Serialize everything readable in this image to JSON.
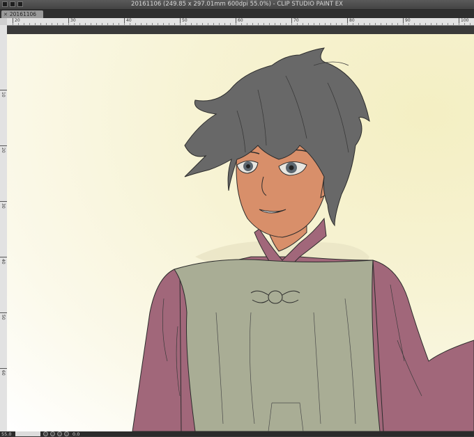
{
  "window": {
    "title": "20161106 (249.85 x 297.01mm 600dpi 55.0%)  - CLIP STUDIO PAINT EX"
  },
  "tabs": [
    {
      "label": "20161106",
      "close_icon": "close-icon"
    }
  ],
  "ruler": {
    "horizontal_labels": [
      "20",
      "30",
      "40",
      "50",
      "60",
      "70",
      "80",
      "90",
      "100"
    ],
    "vertical_labels": [
      "10",
      "20",
      "30",
      "40",
      "50",
      "60"
    ]
  },
  "canvas": {
    "colors": {
      "hair": "#686868",
      "skin": "#d88f6a",
      "shirt": "#a1677a",
      "vest": "#a9ad95",
      "eye": "#5c6770",
      "background": "#f6f2d0",
      "lineart": "#2b2b2b"
    }
  },
  "status": {
    "zoom": "55.0",
    "rotation": "0.0"
  }
}
